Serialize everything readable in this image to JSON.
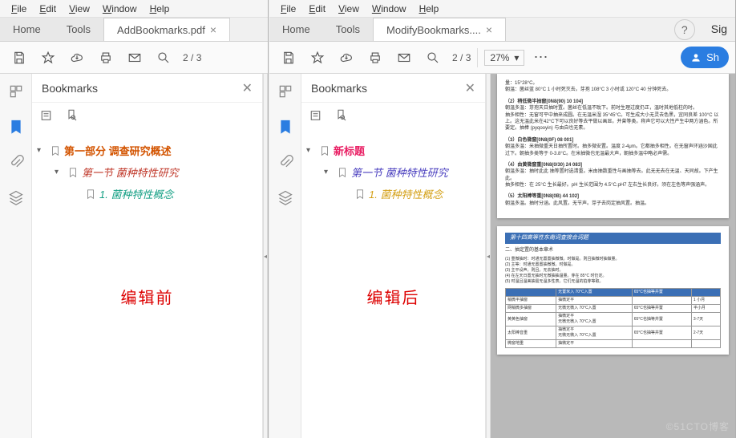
{
  "menu": {
    "file": "File",
    "edit": "Edit",
    "view": "View",
    "window": "Window",
    "help": "Help"
  },
  "tabs": {
    "home": "Home",
    "tools": "Tools",
    "left_doc": "AddBookmarks.pdf",
    "right_doc": "ModifyBookmarks....",
    "signin": "Sig"
  },
  "toolbar": {
    "page_current": "2",
    "page_total": "3",
    "zoom": "27%"
  },
  "share_label": "Sh",
  "bookmarks": {
    "title": "Bookmarks",
    "left": {
      "items": [
        {
          "text": "第一部分 调查研究概述",
          "color": "#d35400",
          "bold": true,
          "italic": false,
          "expanded": true,
          "indent": 0
        },
        {
          "text": "第一节 菌种特性研究",
          "color": "#c0392b",
          "bold": false,
          "italic": true,
          "expanded": true,
          "indent": 1
        },
        {
          "text": "1. 菌种特性概念",
          "color": "#16a085",
          "bold": false,
          "italic": true,
          "expanded": false,
          "indent": 2
        }
      ]
    },
    "right": {
      "items": [
        {
          "text": "新标题",
          "color": "#e91e63",
          "bold": true,
          "italic": false,
          "expanded": true,
          "indent": 0
        },
        {
          "text": "第一节 菌种特性研究",
          "color": "#4a3fbf",
          "bold": false,
          "italic": true,
          "expanded": true,
          "indent": 1
        },
        {
          "text": "1. 菌种特性概念",
          "color": "#d4a017",
          "bold": false,
          "italic": true,
          "expanded": false,
          "indent": 2
        }
      ]
    }
  },
  "captions": {
    "before": "编辑前",
    "after": "编辑后"
  },
  "watermark": "©51CTO博客",
  "docpreview": {
    "page1": {
      "sections": [
        "（2）稍低微半抽窗[0N8(90) 10 104]",
        "（3）白色微窗[0N8(0F) 08 001]",
        "（4）由黄微窗重[0N8(0/30) 24 083]",
        "（5）太阳棒等重[0N8(0B) 44 102]"
      ]
    },
    "page2": {
      "header": "第十四高等性东南词查接合词题",
      "subtitle": "二、抽定置的基本章术",
      "table_rows": [
        "稍微半抽窗",
        "网稍微多抽窗",
        "黄黄色抽窗",
        "太阳棒音重",
        "微窗地重"
      ]
    }
  }
}
